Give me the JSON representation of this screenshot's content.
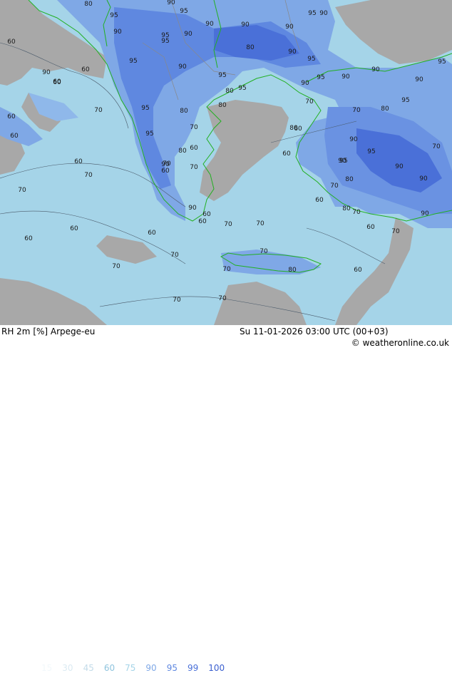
{
  "title": "RH 2m [%] Arpege-eu",
  "datetime": "Su 11-01-2026 03:00 UTC (00+03)",
  "copyright": "© weatheronline.co.uk",
  "legend": [
    {
      "label": "15",
      "color": "#f2f8fb"
    },
    {
      "label": "30",
      "color": "#dbeaf2"
    },
    {
      "label": "45",
      "color": "#c3dbe9"
    },
    {
      "label": "60",
      "color": "#8fc4de"
    },
    {
      "label": "75",
      "color": "#a5d4e8"
    },
    {
      "label": "90",
      "color": "#7fa8e6"
    },
    {
      "label": "95",
      "color": "#5f88e0"
    },
    {
      "label": "99",
      "color": "#4a70d8"
    },
    {
      "label": "100",
      "color": "#3a5fcf"
    }
  ],
  "contour_labels": [
    "80",
    "95",
    "90",
    "95",
    "90",
    "95",
    "95",
    "90",
    "90",
    "60",
    "90",
    "95",
    "90",
    "90",
    "80",
    "90",
    "95",
    "95",
    "90",
    "95",
    "60",
    "95",
    "90",
    "60",
    "90",
    "90",
    "95",
    "95",
    "80",
    "90",
    "95",
    "70",
    "80",
    "90",
    "60",
    "70",
    "95",
    "80",
    "70",
    "80",
    "95",
    "70",
    "60",
    "80",
    "60",
    "60",
    "90",
    "95",
    "70",
    "60",
    "95",
    "70",
    "70",
    "60",
    "90",
    "90",
    "90",
    "80",
    "90",
    "60",
    "60",
    "70",
    "70",
    "70",
    "80",
    "60",
    "60",
    "90",
    "80",
    "60",
    "70",
    "90",
    "70",
    "60",
    "70",
    "70",
    "60",
    "60",
    "70",
    "70",
    "70",
    "60",
    "70",
    "70",
    "70",
    "80",
    "60"
  ]
}
